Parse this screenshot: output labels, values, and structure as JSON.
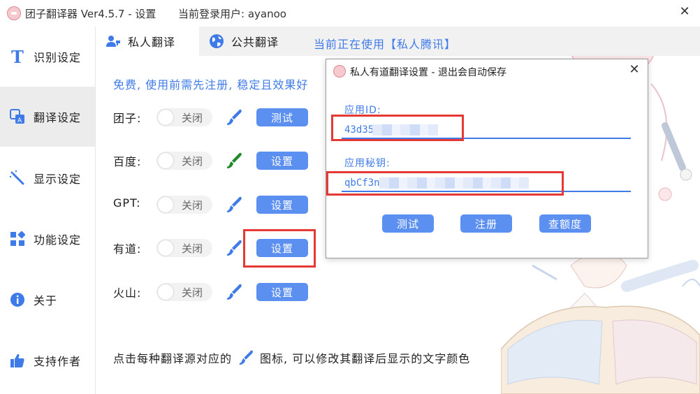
{
  "window": {
    "title": "团子翻译器 Ver4.5.7 - 设置",
    "login_status": "当前登录用户: ayanoo",
    "close_glyph": "✕"
  },
  "sidebar": {
    "items": [
      {
        "label": "识别设定",
        "icon": "text-t-icon",
        "active": false
      },
      {
        "label": "翻译设定",
        "icon": "translate-icon",
        "active": true
      },
      {
        "label": "显示设定",
        "icon": "magic-wand-icon",
        "active": false
      },
      {
        "label": "功能设定",
        "icon": "grid-icon",
        "active": false
      },
      {
        "label": "关于",
        "icon": "info-icon",
        "active": false
      },
      {
        "label": "支持作者",
        "icon": "thumbs-up-icon",
        "active": false
      }
    ]
  },
  "tabs": [
    {
      "label": "私人翻译",
      "icon": "person-key-icon",
      "active": true
    },
    {
      "label": "公共翻译",
      "icon": "globe-icon",
      "active": false
    }
  ],
  "current_using": "当前正在使用【私人腾讯】",
  "notice": "免费, 使用前需先注册, 稳定且效果好",
  "translators": [
    {
      "label": "团子:",
      "toggle_text": "关闭",
      "brush_color": "#3f7be8",
      "button": "测试"
    },
    {
      "label": "百度:",
      "toggle_text": "关闭",
      "brush_color": "#1e8a2a",
      "button": "设置"
    },
    {
      "label": "GPT:",
      "toggle_text": "关闭",
      "brush_color": "#3f7be8",
      "button": "设置"
    },
    {
      "label": "有道:",
      "toggle_text": "关闭",
      "brush_color": "#3f7be8",
      "button": "设置"
    },
    {
      "label": "火山:",
      "toggle_text": "关闭",
      "brush_color": "#3f7be8",
      "button": "设置"
    }
  ],
  "hint": {
    "before": "点击每种翻译源对应的",
    "after": "图标, 可以修改其翻译后显示的文字颜色"
  },
  "dialog": {
    "title": "私人有道翻译设置 - 退出会自动保存",
    "close_glyph": "✕",
    "app_id_label": "应用ID:",
    "app_id_value": "43d35",
    "app_secret_label": "应用秘钥:",
    "app_secret_value": "qbCf3n",
    "buttons": {
      "test": "测试",
      "register": "注册",
      "quota": "查额度"
    }
  },
  "colors": {
    "accent": "#3f7be8",
    "button": "#5b8ff0",
    "highlight": "#e53935",
    "sidebar_active": "#ececec"
  }
}
